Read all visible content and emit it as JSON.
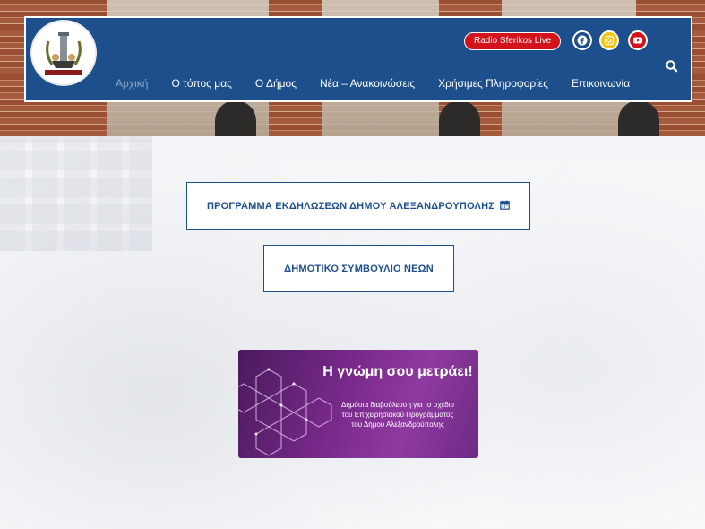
{
  "nav": {
    "items": [
      {
        "label": "Αρχική",
        "active": true
      },
      {
        "label": "Ο τόπος μας",
        "active": false
      },
      {
        "label": "Ο Δήμος",
        "active": false
      },
      {
        "label": "Νέα – Ανακοινώσεις",
        "active": false
      },
      {
        "label": "Χρήσιμες Πληροφορίες",
        "active": false
      },
      {
        "label": "Επικοινωνία",
        "active": false
      }
    ],
    "radio_label": "Radio Sferikos Live",
    "social": [
      "facebook-icon",
      "instagram-icon",
      "youtube-icon"
    ],
    "search_icon": "search-icon"
  },
  "buttons": {
    "program_label": "ΠΡΟΓΡΑΜΜΑ ΕΚΔΗΛΩΣΕΩΝ ΔΗΜΟΥ ΑΛΕΞΑΝΔΡΟΥΠΟΛΗΣ",
    "youth_council_label": "ΔΗΜΟΤΙΚΟ ΣΥΜΒΟΥΛΙΟ ΝΕΩΝ"
  },
  "banner": {
    "title": "Η γνώμη σου μετράει!",
    "lines": [
      "Δημόσια διαβούλευση για το σχέδιο",
      "του Επιχειρησιακού Προγράμματος",
      "του Δήμου Αλεξανδρούπολης"
    ]
  },
  "colors": {
    "primary": "#1c4f8c",
    "radio_red": "#d3131b",
    "instagram_yellow": "#f4c314",
    "banner_purple": "#7a2a8c"
  }
}
